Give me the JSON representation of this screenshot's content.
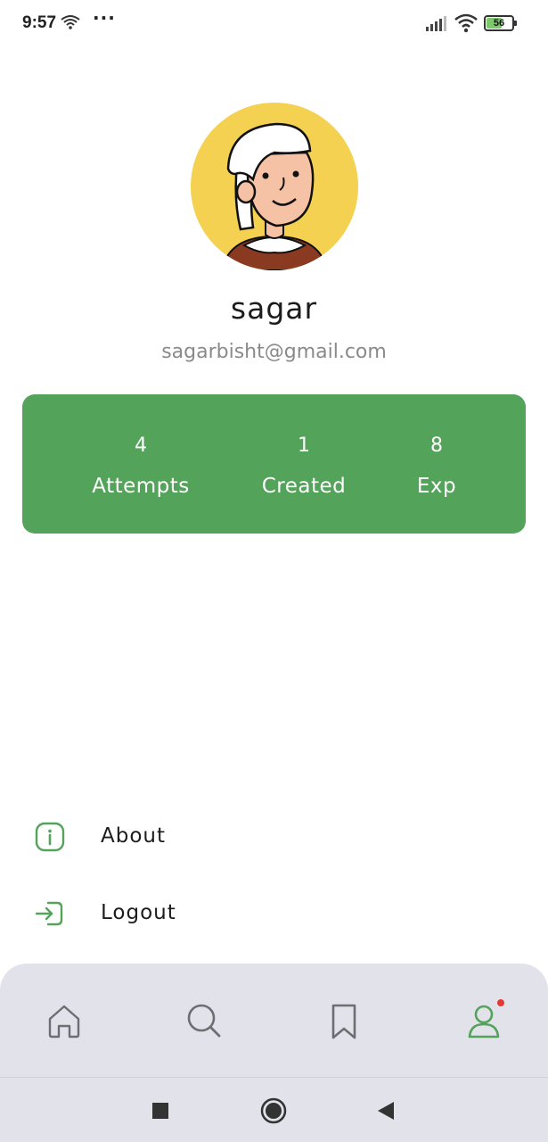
{
  "status_bar": {
    "time": "9:57",
    "more": "···",
    "battery_level": "56",
    "battery_fraction": 0.56
  },
  "profile": {
    "name": "sagar",
    "email": "sagarbisht@gmail.com",
    "avatar_icon": "user-avatar-illustration"
  },
  "stats": [
    {
      "value": "4",
      "label": "Attempts"
    },
    {
      "value": "1",
      "label": "Created"
    },
    {
      "value": "8",
      "label": "Exp"
    }
  ],
  "menu": [
    {
      "label": "About",
      "icon": "info-icon"
    },
    {
      "label": "Logout",
      "icon": "logout-icon"
    }
  ],
  "bottom_nav": {
    "items": [
      "home-icon",
      "search-icon",
      "bookmark-icon",
      "profile-icon"
    ],
    "active": "profile-icon",
    "notification_dot": true
  },
  "colors": {
    "accent": "#54a35a",
    "avatar_bg": "#f4d150",
    "nav_bg": "#e2e3ea",
    "notification": "#e53935"
  }
}
